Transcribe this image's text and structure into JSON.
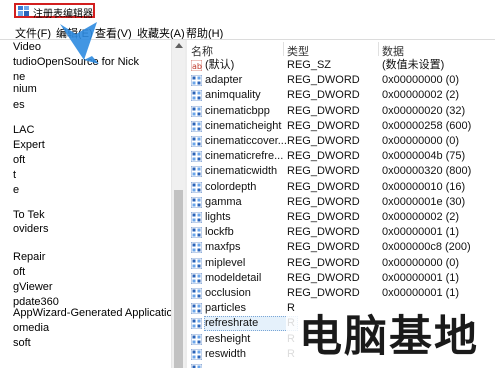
{
  "window": {
    "title": "注册表编辑器"
  },
  "menu": [
    "文件(F)",
    "编辑(E)",
    "查看(V)",
    "收藏夹(A)",
    "帮助(H)"
  ],
  "tree": [
    "Video",
    "tudioOpenSource for Nick",
    "ne",
    "nium",
    "es",
    "LAC",
    "Expert",
    "oft",
    "t",
    "e",
    "",
    "To Tek",
    "oviders",
    "",
    "",
    "Repair",
    "oft",
    "gViewer",
    "pdate360",
    "AppWizard-Generated Applicatio",
    "omedia",
    "soft",
    "",
    ""
  ],
  "columns": {
    "name": "名称",
    "type": "类型",
    "data": "数据"
  },
  "rows": [
    {
      "name": "(默认)",
      "type": "REG_SZ",
      "data": "(数值未设置)",
      "icon": "ab"
    },
    {
      "name": "adapter",
      "type": "REG_DWORD",
      "data": "0x00000000 (0)",
      "icon": "bin"
    },
    {
      "name": "animquality",
      "type": "REG_DWORD",
      "data": "0x00000002 (2)",
      "icon": "bin"
    },
    {
      "name": "cinematicbpp",
      "type": "REG_DWORD",
      "data": "0x00000020 (32)",
      "icon": "bin"
    },
    {
      "name": "cinematicheight",
      "type": "REG_DWORD",
      "data": "0x00000258 (600)",
      "icon": "bin"
    },
    {
      "name": "cinematiccover...",
      "type": "REG_DWORD",
      "data": "0x00000000 (0)",
      "icon": "bin"
    },
    {
      "name": "cinematicrefre...",
      "type": "REG_DWORD",
      "data": "0x0000004b (75)",
      "icon": "bin"
    },
    {
      "name": "cinematicwidth",
      "type": "REG_DWORD",
      "data": "0x00000320 (800)",
      "icon": "bin"
    },
    {
      "name": "colordepth",
      "type": "REG_DWORD",
      "data": "0x00000010 (16)",
      "icon": "bin"
    },
    {
      "name": "gamma",
      "type": "REG_DWORD",
      "data": "0x0000001e (30)",
      "icon": "bin"
    },
    {
      "name": "lights",
      "type": "REG_DWORD",
      "data": "0x00000002 (2)",
      "icon": "bin"
    },
    {
      "name": "lockfb",
      "type": "REG_DWORD",
      "data": "0x00000001 (1)",
      "icon": "bin"
    },
    {
      "name": "maxfps",
      "type": "REG_DWORD",
      "data": "0x000000c8 (200)",
      "icon": "bin"
    },
    {
      "name": "miplevel",
      "type": "REG_DWORD",
      "data": "0x00000000 (0)",
      "icon": "bin"
    },
    {
      "name": "modeldetail",
      "type": "REG_DWORD",
      "data": "0x00000001 (1)",
      "icon": "bin"
    },
    {
      "name": "occlusion",
      "type": "REG_DWORD",
      "data": "0x00000001 (1)",
      "icon": "bin"
    },
    {
      "name": "particles",
      "type": "R",
      "data": "",
      "icon": "bin"
    },
    {
      "name": "refreshrate",
      "type": "R",
      "data": "",
      "icon": "bin",
      "selected": true
    },
    {
      "name": "resheight",
      "type": "R",
      "data": "",
      "icon": "bin"
    },
    {
      "name": "reswidth",
      "type": "R",
      "data": "",
      "icon": "bin"
    },
    {
      "name": "",
      "type": "",
      "data": "",
      "icon": "bin"
    }
  ],
  "watermark": "电脑基地",
  "colors": {
    "highlight_border": "#d21f1f",
    "arrow": "#2e8be0",
    "selection": "#e5f1fb"
  }
}
